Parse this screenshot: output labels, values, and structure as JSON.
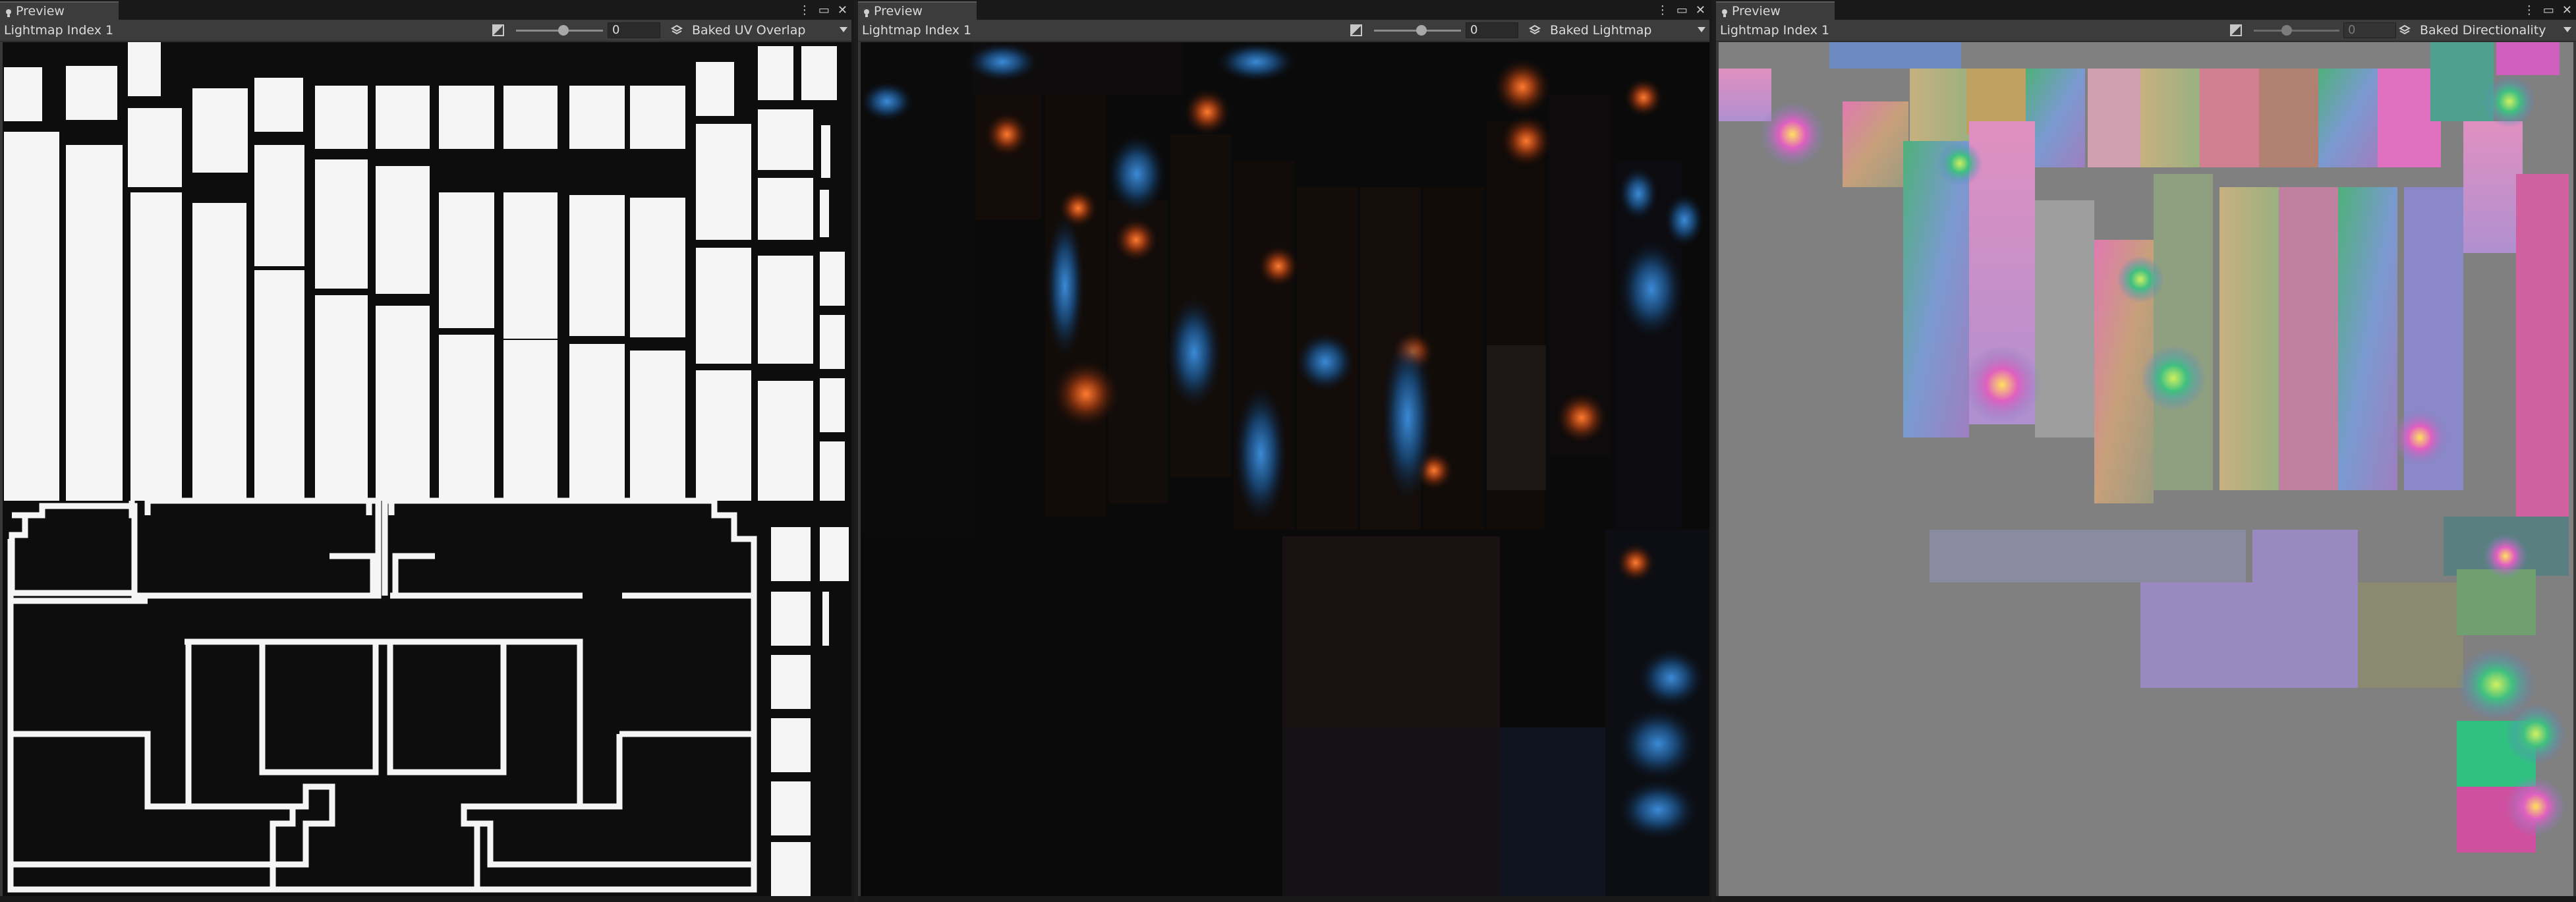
{
  "panels": [
    {
      "tab_label": "Preview",
      "title": "Lightmap Index 1",
      "exposure_value": "0",
      "mode": "Baked UV Overlap"
    },
    {
      "tab_label": "Preview",
      "title": "Lightmap Index 1",
      "exposure_value": "0",
      "mode": "Baked Lightmap"
    },
    {
      "tab_label": "Preview",
      "title": "Lightmap Index 1",
      "exposure_value": "0",
      "mode": "Baked Directionality"
    }
  ],
  "icons": {
    "menu": "kebab-menu-icon",
    "maximize": "maximize-icon",
    "close": "close-icon",
    "tab": "lightbulb-icon",
    "exposure": "exposure-icon",
    "layers": "layers-icon"
  },
  "colors": {
    "uv_island": "#f5f5f5",
    "uv_background": "#0d0d0d",
    "lightmap_bg": "#0a0a0a",
    "directionality_bg": "#808080"
  }
}
